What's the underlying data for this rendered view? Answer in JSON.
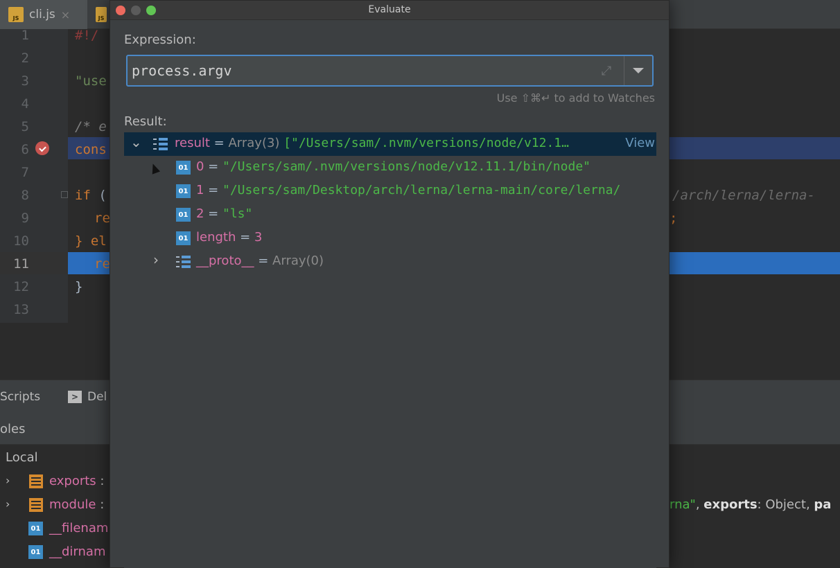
{
  "editor": {
    "tabs": [
      {
        "label": "cli.js",
        "badge": "JS",
        "close": "×"
      },
      {
        "label": "",
        "badge": "JS"
      }
    ],
    "line_numbers": [
      "1",
      "2",
      "3",
      "4",
      "5",
      "6",
      "7",
      "8",
      "9",
      "10",
      "11",
      "12",
      "13"
    ],
    "code_fragments": {
      "l1": "#!/",
      "l3": "\"use",
      "l5": "/* e",
      "l6": "cons",
      "l8_kw": "if",
      "l8_rest": " (",
      "l9": "re",
      "l10": "} el",
      "l11": "re",
      "l12": "}"
    },
    "right_code": {
      "l8": "/arch/lerna/lerna-",
      "l9": ";"
    }
  },
  "tool_tabs": {
    "scripts": "Scripts",
    "debugger": "Del",
    "console_icon": ">"
  },
  "variables": {
    "header": "oles",
    "scope": "Local",
    "items": [
      {
        "name": "exports",
        "suffix": " :"
      },
      {
        "name": "module",
        "suffix": " :"
      },
      {
        "name": "__filenam",
        "suffix": ""
      },
      {
        "name": "__dirnam",
        "suffix": ""
      }
    ],
    "module_value_tail_str": "rna\"",
    "module_value_tail_rest": ", ",
    "module_value_key": "exports",
    "module_value_type": ": Object, ",
    "module_value_more": "pa"
  },
  "dialog": {
    "title": "Evaluate",
    "expression_label": "Expression:",
    "expression_value": "process.argv",
    "hint": "Use ⇧⌘↵ to add to Watches",
    "result_label": "Result:",
    "result": {
      "name": "result",
      "eq": " = ",
      "type": "Array(3) ",
      "preview": "[\"/Users/sam/.nvm/versions/node/v12.1…",
      "view_link": "View",
      "children": [
        {
          "icon": "01",
          "name": "0",
          "value": "\"/Users/sam/.nvm/versions/node/v12.11.1/bin/node\""
        },
        {
          "icon": "01",
          "name": "1",
          "value": "\"/Users/sam/Desktop/arch/lerna/lerna-main/core/lerna/"
        },
        {
          "icon": "01",
          "name": "2",
          "value": "\"ls\""
        }
      ],
      "length_name": "length",
      "length_value": "3",
      "proto_name": "__proto__",
      "proto_type": "Array(0)"
    }
  },
  "icon_glyphs": {
    "caret_down": "⌄",
    "caret_right": "›",
    "expand": "⤢",
    "primitive": "01"
  },
  "colors": {
    "selection": "#0d293e",
    "string": "#4cb848",
    "name": "#d670a6",
    "focus": "#4a88c7"
  }
}
